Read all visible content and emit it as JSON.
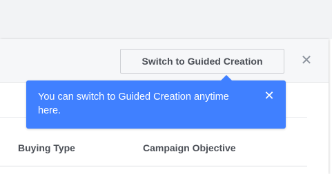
{
  "header": {
    "switch_button_label": "Switch to Guided Creation",
    "close_glyph": "✕"
  },
  "tooltip": {
    "message": "You can switch to Guided Creation anytime here.",
    "close_glyph": "✕"
  },
  "table": {
    "columns": [
      "Buying Type",
      "Campaign Objective"
    ]
  },
  "icons": {
    "dialog_close": "close-icon",
    "tooltip_close": "close-icon"
  },
  "colors": {
    "tooltip_background": "#4080ff",
    "header_background": "#f6f7f9",
    "button_text": "#4b4f56"
  }
}
